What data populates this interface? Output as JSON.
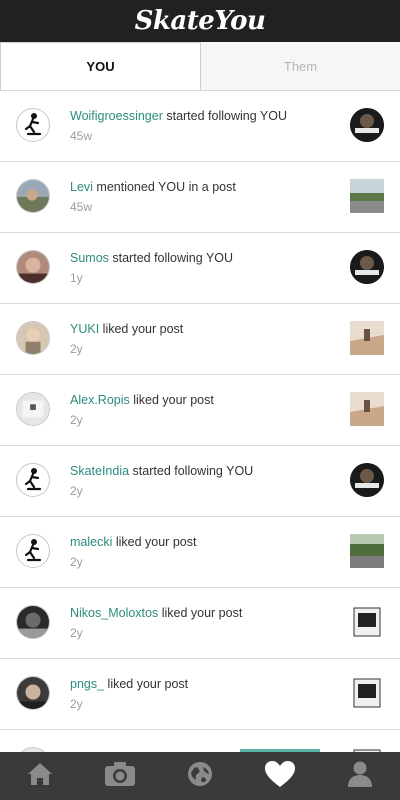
{
  "app": {
    "title": "SkateYou"
  },
  "tabs": [
    {
      "label": "YOU",
      "active": true
    },
    {
      "label": "Them",
      "active": false
    }
  ],
  "notifications": [
    {
      "user": "Woifigroessinger",
      "action": " started following YOU",
      "time": "45w"
    },
    {
      "user": "Levi",
      "action": " mentioned YOU in a post",
      "time": "45w"
    },
    {
      "user": "Sumos",
      "action": " started following YOU",
      "time": "1y"
    },
    {
      "user": "YUKI",
      "action": " liked your post",
      "time": "2y"
    },
    {
      "user": "Alex.Ropis",
      "action": " liked your post",
      "time": "2y"
    },
    {
      "user": "SkateIndia",
      "action": " started following YOU",
      "time": "2y"
    },
    {
      "user": "malecki",
      "action": " liked your post",
      "time": "2y"
    },
    {
      "user": "Nikos_Moloxtos",
      "action": " liked your post",
      "time": "2y"
    },
    {
      "user": "pngs_",
      "action": " liked your post",
      "time": "2y"
    }
  ],
  "nav": [
    {
      "icon": "home-icon"
    },
    {
      "icon": "camera-icon"
    },
    {
      "icon": "globe-icon"
    },
    {
      "icon": "heart-icon"
    },
    {
      "icon": "profile-icon"
    }
  ],
  "colors": {
    "header": "#212121",
    "username": "#2c8c7e",
    "nav_bg": "#3a3a3a",
    "active_indicator": "#5bb3a7"
  }
}
